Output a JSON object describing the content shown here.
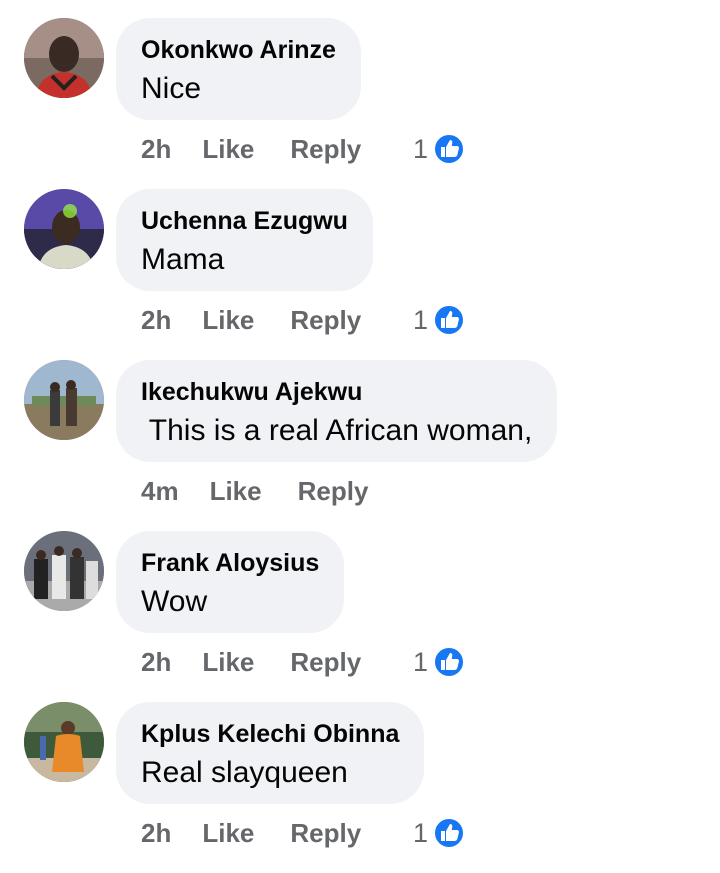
{
  "accent_color": "#1877f2",
  "labels": {
    "like": "Like",
    "reply": "Reply"
  },
  "comments": [
    {
      "author": "Okonkwo Arinze",
      "text": "Nice",
      "time": "2h",
      "reactions": "1",
      "avatar": "avatar-man-red-shirt"
    },
    {
      "author": "Uchenna Ezugwu",
      "text": "Mama",
      "time": "2h",
      "reactions": "1",
      "avatar": "avatar-man-green-light"
    },
    {
      "author": "Ikechukwu Ajekwu",
      "text": " This is a real African woman,",
      "time": "4m",
      "reactions": "",
      "avatar": "avatar-two-people-outdoor"
    },
    {
      "author": "Frank Aloysius",
      "text": "Wow",
      "time": "2h",
      "reactions": "1",
      "avatar": "avatar-group-photo"
    },
    {
      "author": "Kplus Kelechi Obinna",
      "text": "Real slayqueen",
      "time": "2h",
      "reactions": "1",
      "avatar": "avatar-person-orange-outfit"
    }
  ]
}
